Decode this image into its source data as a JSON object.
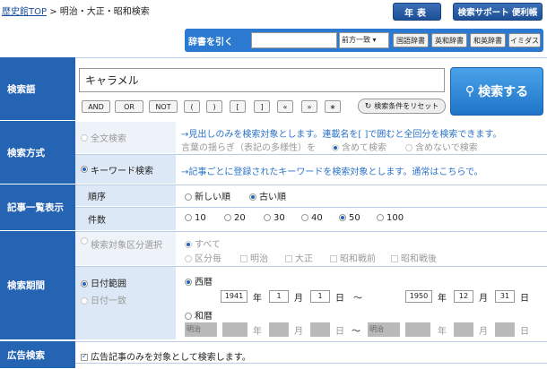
{
  "breadcrumb": {
    "home": "歴史館TOP",
    "sep": " > ",
    "current": "明治・大正・昭和検索"
  },
  "top_buttons": {
    "nenpyo": "年表",
    "support": "検索サポート 便利帳"
  },
  "dict": {
    "label": "辞書を引く",
    "select": "前方一致 ▾",
    "buttons": [
      "国語辞書",
      "英和辞書",
      "和英辞書",
      "イミダス"
    ]
  },
  "search": {
    "label": "検索語",
    "value": "キャラメル",
    "ops": [
      "AND",
      "OR",
      "NOT",
      "(",
      ")",
      "[",
      "]",
      "«",
      "»",
      "∗"
    ],
    "reset": "検索条件をリセット",
    "submit": "検索する"
  },
  "method": {
    "label": "検索方式",
    "fulltext": "全文検索",
    "fulltext_desc": "→見出しのみを検索対象とします。連載名を[ ]で囲むと全回分を検索できます。",
    "variant_label": "言葉の揺らぎ（表記の多様性）を",
    "variant_on": "含めて検索",
    "variant_off": "含めないで検索",
    "keyword": "キーワード検索",
    "keyword_desc": "→記事ごとに登録されたキーワードを検索対象とします。通常はこちらで。"
  },
  "list": {
    "label": "記事一覧表示",
    "order_label": "順序",
    "order_new": "新しい順",
    "order_old": "古い順",
    "count_label": "件数",
    "counts": [
      "10",
      "20",
      "30",
      "40",
      "50",
      "100"
    ],
    "selected_count": "50"
  },
  "period": {
    "label": "検索期間",
    "category_select": "検索対象区分選択",
    "all": "すべて",
    "by_period": "区分毎",
    "eras": [
      "明治",
      "大正",
      "昭和戦前",
      "昭和戦後"
    ],
    "date_range": "日付範囲",
    "single_date": "日付一致",
    "western": "西暦",
    "japanese": "和暦",
    "from": {
      "year": "1941",
      "month": "1",
      "day": "1"
    },
    "to": {
      "year": "1950",
      "month": "12",
      "day": "31"
    },
    "u_year": "年",
    "u_month": "月",
    "u_day": "日",
    "tilde": "〜",
    "era_select": "明治"
  },
  "ad": {
    "label": "広告検索",
    "text": "広告記事のみを対象として検索します。"
  },
  "colors": {
    "label_bg": "#2563b3",
    "sublabel_bg": "#dce8f5",
    "search_btn": "#2b86d6",
    "link": "#2a73c9"
  }
}
